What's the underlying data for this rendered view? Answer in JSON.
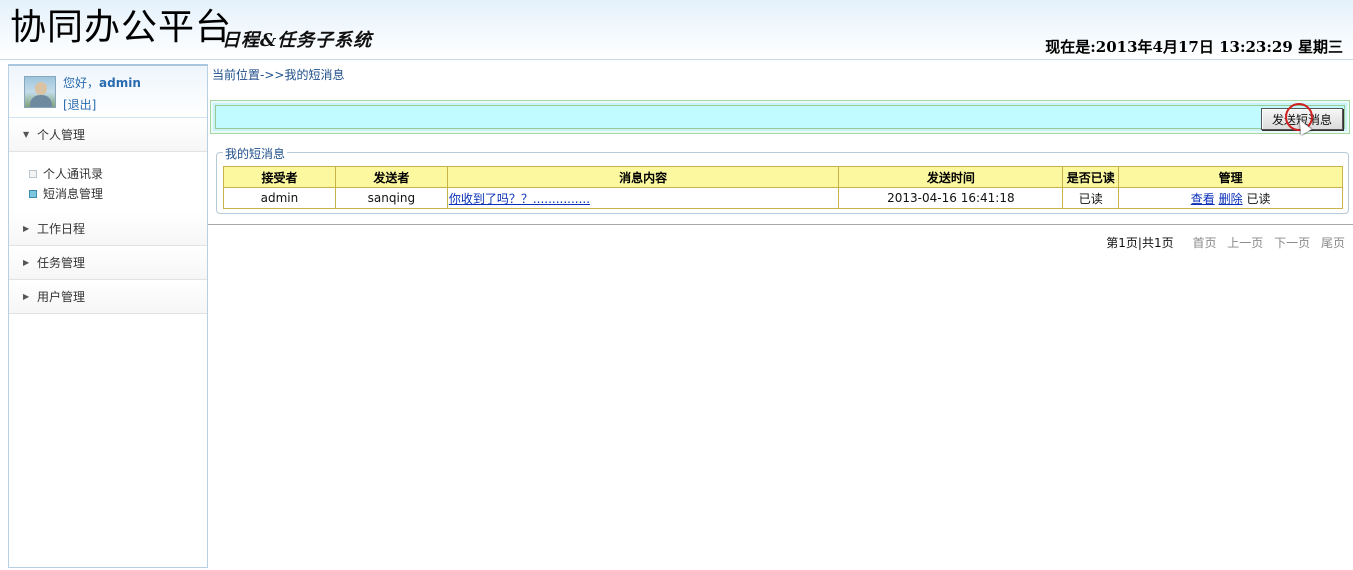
{
  "header": {
    "title": "协同办公平台",
    "subtitle": "日程&任务子系统",
    "clock": "现在是:2013年4月17日 13:23:29 星期三"
  },
  "sidebar": {
    "greeting": "您好，",
    "username": "admin",
    "logout": "[退出]",
    "groups": [
      {
        "label": "个人管理",
        "expanded": true,
        "items": [
          {
            "label": "个人通讯录",
            "active": false
          },
          {
            "label": "短消息管理",
            "active": true
          }
        ]
      },
      {
        "label": "工作日程",
        "expanded": false
      },
      {
        "label": "任务管理",
        "expanded": false
      },
      {
        "label": "用户管理",
        "expanded": false
      }
    ]
  },
  "main": {
    "breadcrumb": "当前位置->>我的短消息",
    "send_button": "发送短消息",
    "section_title": "我的短消息",
    "table": {
      "headers": [
        "接受者",
        "发送者",
        "消息内容",
        "发送时间",
        "是否已读",
        "管理"
      ],
      "rows": [
        {
          "receiver": "admin",
          "sender": "sanqing",
          "content": "你收到了吗？？...............",
          "time": "2013-04-16 16:41:18",
          "read": "已读",
          "view": "查看",
          "delete": "删除",
          "status": "已读"
        }
      ]
    },
    "pager": {
      "info": "第1页|共1页",
      "first": "首页",
      "prev": "上一页",
      "next": "下一页",
      "last": "尾页"
    }
  },
  "icons": {
    "expanded": "triangle-down",
    "collapsed": "triangle-right"
  },
  "colors": {
    "header_bg": "#e4f1fb",
    "toolbar_bg": "#c1fbff",
    "table_header_bg": "#fbf8a0",
    "link": "#0a2fb8",
    "accent_text": "#2a6cb0"
  }
}
